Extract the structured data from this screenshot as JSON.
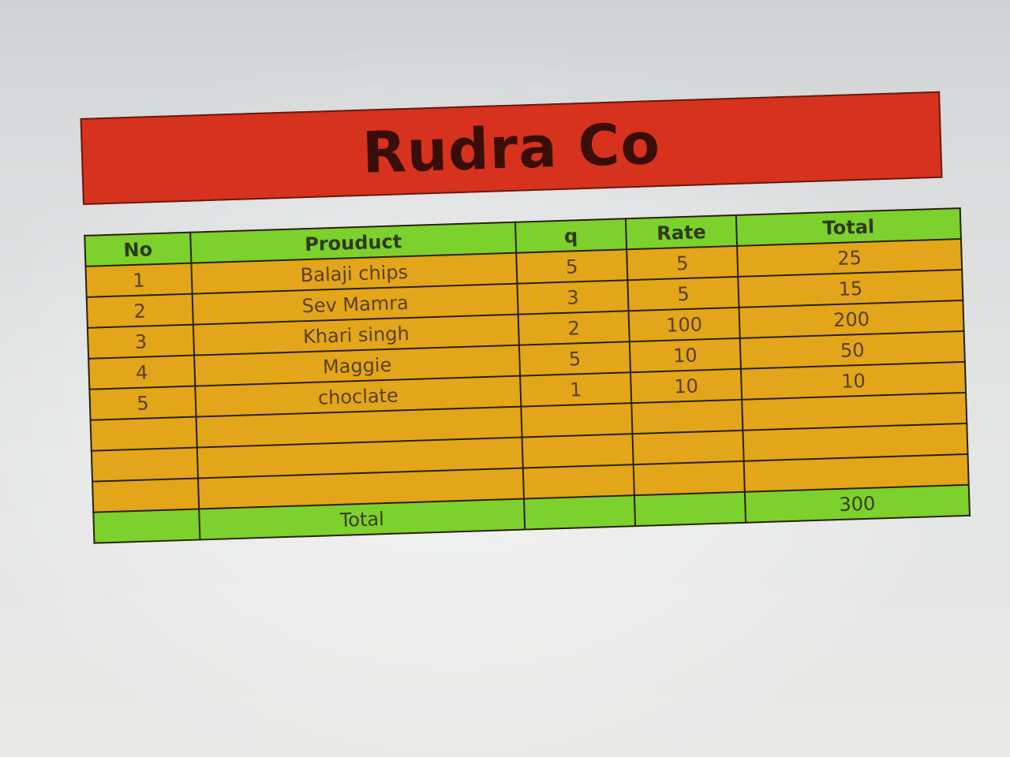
{
  "title": "Rudra Co",
  "headers": {
    "no": "No",
    "product": "Prouduct",
    "q": "q",
    "rate": "Rate",
    "total": "Total"
  },
  "rows": [
    {
      "no": "1",
      "product": "Balaji chips",
      "q": "5",
      "rate": "5",
      "total": "25"
    },
    {
      "no": "2",
      "product": "Sev Mamra",
      "q": "3",
      "rate": "5",
      "total": "15"
    },
    {
      "no": "3",
      "product": "Khari singh",
      "q": "2",
      "rate": "100",
      "total": "200"
    },
    {
      "no": "4",
      "product": "Maggie",
      "q": "5",
      "rate": "10",
      "total": "50"
    },
    {
      "no": "5",
      "product": "choclate",
      "q": "1",
      "rate": "10",
      "total": "10"
    }
  ],
  "footer": {
    "label": "Total",
    "grand_total": "300"
  },
  "colors": {
    "banner": "#d6321d",
    "header_green": "#7cd12c",
    "row_orange": "#e3a61a"
  }
}
